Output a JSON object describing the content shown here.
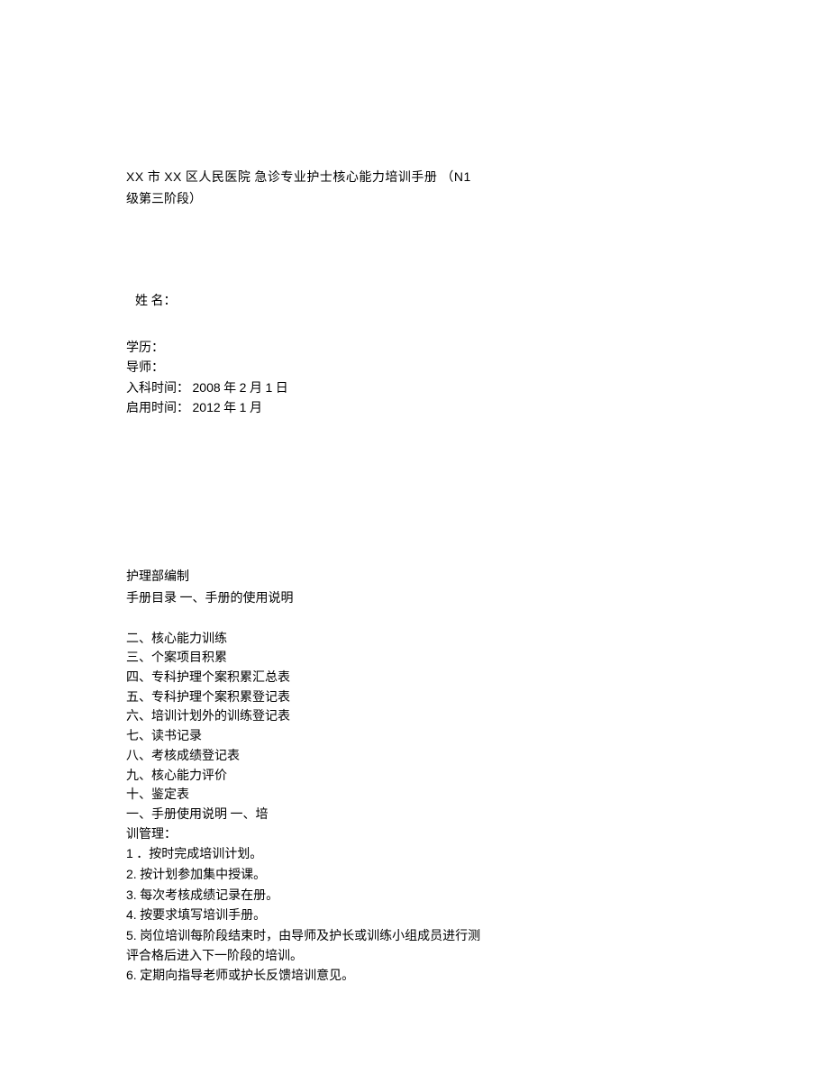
{
  "title": {
    "line1_prefix": "XX",
    "line1_mid1": " 市 ",
    "line1_prefix2": "XX",
    "line1_mid2": " 区人民医院  急诊专业护士核心能力培训手册 （",
    "line1_suffix": "N1",
    "line2": "级第三阶段）"
  },
  "name": {
    "label": "姓  名："
  },
  "info": {
    "education": "学历：",
    "mentor": "导师：",
    "entry_label": "入科时间：  ",
    "entry_year": "2008",
    "entry_year_suffix": " 年  ",
    "entry_month": "2",
    "entry_month_suffix": " 月  ",
    "entry_day": "1",
    "entry_day_suffix": " 日",
    "start_label": "启用时间：  ",
    "start_year": "2012",
    "start_year_suffix": " 年  ",
    "start_month": "1",
    "start_month_suffix": " 月"
  },
  "publisher": "护理部编制",
  "toc_title": "手册目录  一、手册的使用说明",
  "items": {
    "i2": "二、核心能力训练",
    "i3": "三、个案项目积累",
    "i4": "四、专科护理个案积累汇总表",
    "i5": "五、专科护理个案积累登记表",
    "i6": "六、培训计划外的训练登记表",
    "i7": "七、读书记录",
    "i8": "八、考核成绩登记表",
    "i9": "九、核心能力评价",
    "i10": "十、鉴定表",
    "i11": "一、手册使用说明  一、培",
    "i12": "训管理：",
    "n1_prefix": "1",
    "n1": " ．按时完成培训计划。",
    "n2_prefix": "2.",
    "n2": "  按计划参加集中授课。",
    "n3_prefix": "3.",
    "n3": "  每次考核成绩记录在册。",
    "n4_prefix": "4.",
    "n4": "  按要求填写培训手册。",
    "n5_prefix": "5.",
    "n5": "  岗位培训每阶段结束时，由导师及护长或训练小组成员进行测",
    "n5b": "评合格后进入下一阶段的培训。",
    "n6_prefix": "6.",
    "n6": "  定期向指导老师或护长反馈培训意见。"
  }
}
